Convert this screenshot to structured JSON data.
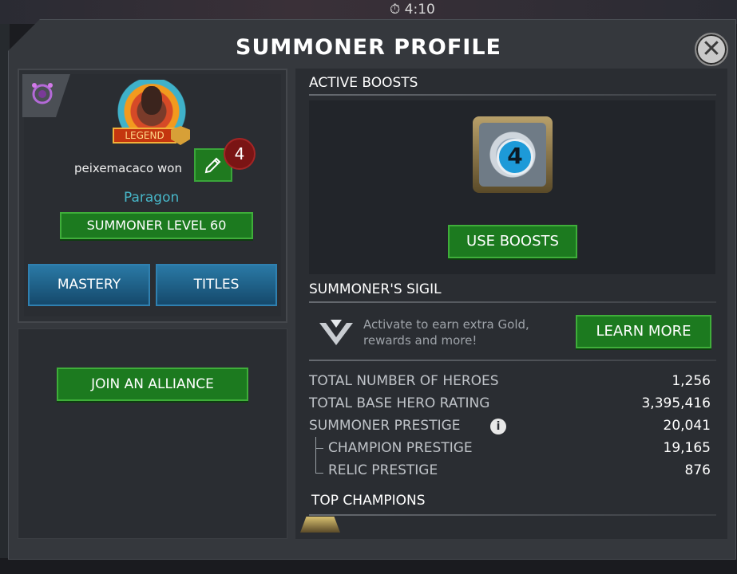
{
  "status_bar": {
    "time": "4:10"
  },
  "modal": {
    "title": "SUMMONER PROFILE"
  },
  "profile": {
    "rank_badge": "LEGEND",
    "summoner_name": "peixemacaco won",
    "notification_count": "4",
    "player_title": "Paragon",
    "level_button": "SUMMONER LEVEL 60",
    "tabs": [
      {
        "label": "MASTERY"
      },
      {
        "label": "TITLES"
      }
    ],
    "join_alliance_button": "JOIN AN ALLIANCE"
  },
  "boosts": {
    "heading": "ACTIVE BOOSTS",
    "use_button": "USE BOOSTS"
  },
  "sigil": {
    "heading": "SUMMONER'S SIGIL",
    "description": "Activate to earn extra Gold, rewards and more!",
    "learn_more_button": "LEARN MORE"
  },
  "stats": [
    {
      "label": "TOTAL NUMBER OF HEROES",
      "value": "1,256"
    },
    {
      "label": "TOTAL BASE HERO RATING",
      "value": "3,395,416"
    },
    {
      "label": "SUMMONER PRESTIGE",
      "value": "20,041"
    },
    {
      "label": "CHAMPION PRESTIGE",
      "value": "19,165"
    },
    {
      "label": "RELIC PRESTIGE",
      "value": "876"
    }
  ],
  "top_champions": {
    "heading": "TOP CHAMPIONS"
  },
  "colors": {
    "accent_green": "#1c7a1f",
    "accent_blue": "#1f5e84",
    "title_cyan": "#47b6c8",
    "notification_red": "#7a1414"
  },
  "icons": [
    "close-icon",
    "class-icon",
    "pencil-icon",
    "info-icon",
    "sigil-icon",
    "boost-icon",
    "timer-icon"
  ]
}
